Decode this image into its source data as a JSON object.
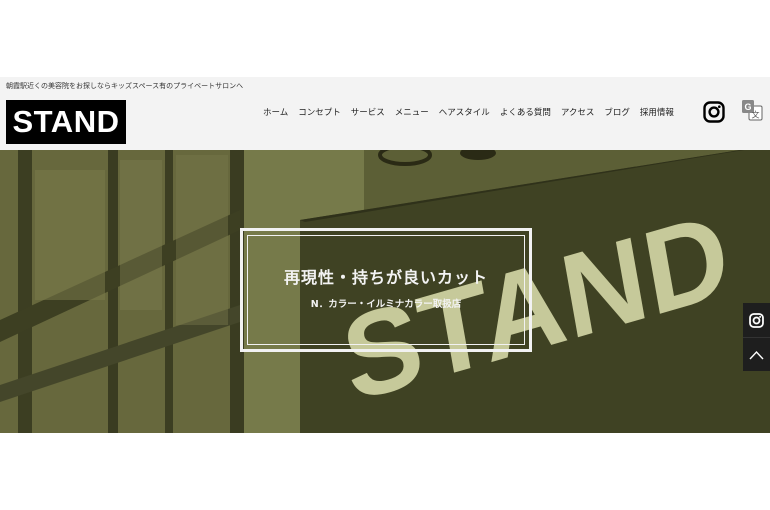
{
  "header": {
    "tagline": "朝霞駅近くの美容院をお探しならキッズスペース有のプライベートサロンへ",
    "logo_text": "STAND",
    "nav": [
      {
        "label": "ホーム"
      },
      {
        "label": "コンセプト"
      },
      {
        "label": "サービス"
      },
      {
        "label": "メニュー"
      },
      {
        "label": "ヘアスタイル"
      },
      {
        "label": "よくある質問"
      },
      {
        "label": "アクセス"
      },
      {
        "label": "ブログ"
      },
      {
        "label": "採用情報"
      }
    ],
    "icons": [
      "instagram-icon",
      "translate-icon"
    ]
  },
  "hero": {
    "sign_text": "STAND",
    "title": "再現性・持ちが良いカット",
    "subtitle": "N．カラー・イルミナカラー取扱店"
  },
  "side_buttons": {
    "icons": [
      "instagram-icon",
      "chevron-up-icon"
    ]
  },
  "colors": {
    "hero_overlay": "#565a33",
    "sign_board": "#3f4223",
    "sign_letters": "#c6c99a",
    "header_bg": "#f3f3f3",
    "logo_bg": "#000000"
  }
}
